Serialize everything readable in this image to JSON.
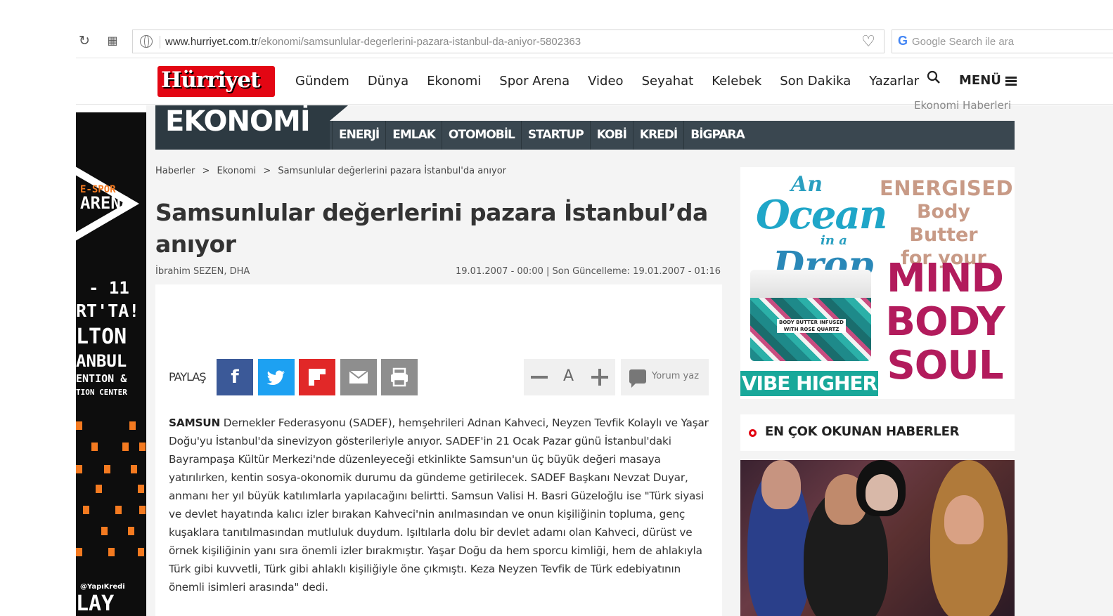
{
  "browser": {
    "url_domain": "www.hurriyet.com.tr",
    "url_path": "/ekonomi/samsunlular-degerlerini-pazara-istanbul-da-aniyor-5802363",
    "search_placeholder": "Google Search ile ara",
    "google_glyph": "G"
  },
  "site": {
    "logo_text": "Hürriyet",
    "nav": [
      "Gündem",
      "Dünya",
      "Ekonomi",
      "Spor Arena",
      "Video",
      "Seyahat",
      "Kelebek",
      "Son Dakika",
      "Yazarlar"
    ],
    "menu_label": "MENÜ"
  },
  "category": {
    "title": "EKONOMİ",
    "subcategories": [
      "ENERJİ",
      "EMLAK",
      "OTOMOBİL",
      "STARTUP",
      "KOBİ",
      "KREDİ",
      "BİGPARA"
    ],
    "section_link": "Ekonomi Haberleri"
  },
  "breadcrumb": [
    "Haberler",
    ">",
    "Ekonomi",
    ">",
    "Samsunlular değerlerini pazara İstanbul'da anıyor"
  ],
  "article": {
    "title": "Samsunlular değerlerini pazara İstanbul’da anıyor",
    "author": "İbrahim SEZEN, DHA",
    "dates": "19.01.2007 - 00:00 | Son Güncelleme: 19.01.2007 - 01:16",
    "share_label": "PAYLAŞ",
    "font_a": "A",
    "comment_label": "Yorum yaz",
    "lead": "SAMSUN",
    "body": " Dernekler Federasyonu (SADEF), hemşehrileri Adnan Kahveci, Neyzen Tevfik Kolaylı ve Yaşar Doğu'yu İstanbul'da sinevizyon gösterileriyle anıyor. SADEF'in 21 Ocak Pazar günü İstanbul'daki Bayrampaşa Kültür Merkezi'nde düzenleyeceği etkinlikte Samsun'un üç büyük değeri masaya yatırılırken, kentin sosya-okonomik durumu da gündeme getirilecek. SADEF Başkanı Nevzat Duyar, anmanı her yıl büyük katılımlarla yapılacağını belirtti. Samsun Valisi H. Basri Güzeloğlu ise \"Türk siyasi ve devlet hayatında kalıcı izler bırakan Kahveci'nin anılmasından ve onun kişiliğinin topluma, genç kuşaklara tanıtılmasından mutluluk duydum. Işıltılarla dolu bir devlet adamı olan Kahveci, dürüst ve örnek kişiliğinin yanı sıra önemli izler bırakmıştır. Yaşar Doğu da hem sporcu kimliği, hem de ahlakıyla Türk gibi kuvvetli, Türk gibi ahlaklı kişiliğiyle öne çıkmıştı. Keza Neyzen Tevfik de Türk edebiyatının önemli isimleri arasında\" dedi."
  },
  "left_ad": {
    "line1": "E-SPOR",
    "line2": "ARENA",
    "line3": "- 11",
    "line4": "RT'TA!",
    "line5": "LTON",
    "line6": "ANBUL",
    "line7": "ENTION &",
    "line8": "TION CENTER",
    "line9": "@YapıKredi",
    "line10": "LAY"
  },
  "right_ad": {
    "ocean_1": "An",
    "ocean_2": "Ocean",
    "ocean_3": "in a",
    "ocean_4": "Drop",
    "energised": "ENERGISED",
    "body_butter": "Body Butter",
    "for_your": "for your",
    "mind": "MIND",
    "body": "BODY",
    "soul": "SOUL",
    "jar_label": "BODY BUTTER INFUSED WITH ROSE QUARTZ",
    "vibe": "VIBE HIGHER"
  },
  "most_read": {
    "label": "EN ÇOK OKUNAN HABERLER"
  },
  "colors": {
    "brand_red": "#e30613",
    "category_bar": "#3a4750",
    "facebook": "#3b5998",
    "twitter": "#1da1f2",
    "flipboard": "#e12828"
  }
}
